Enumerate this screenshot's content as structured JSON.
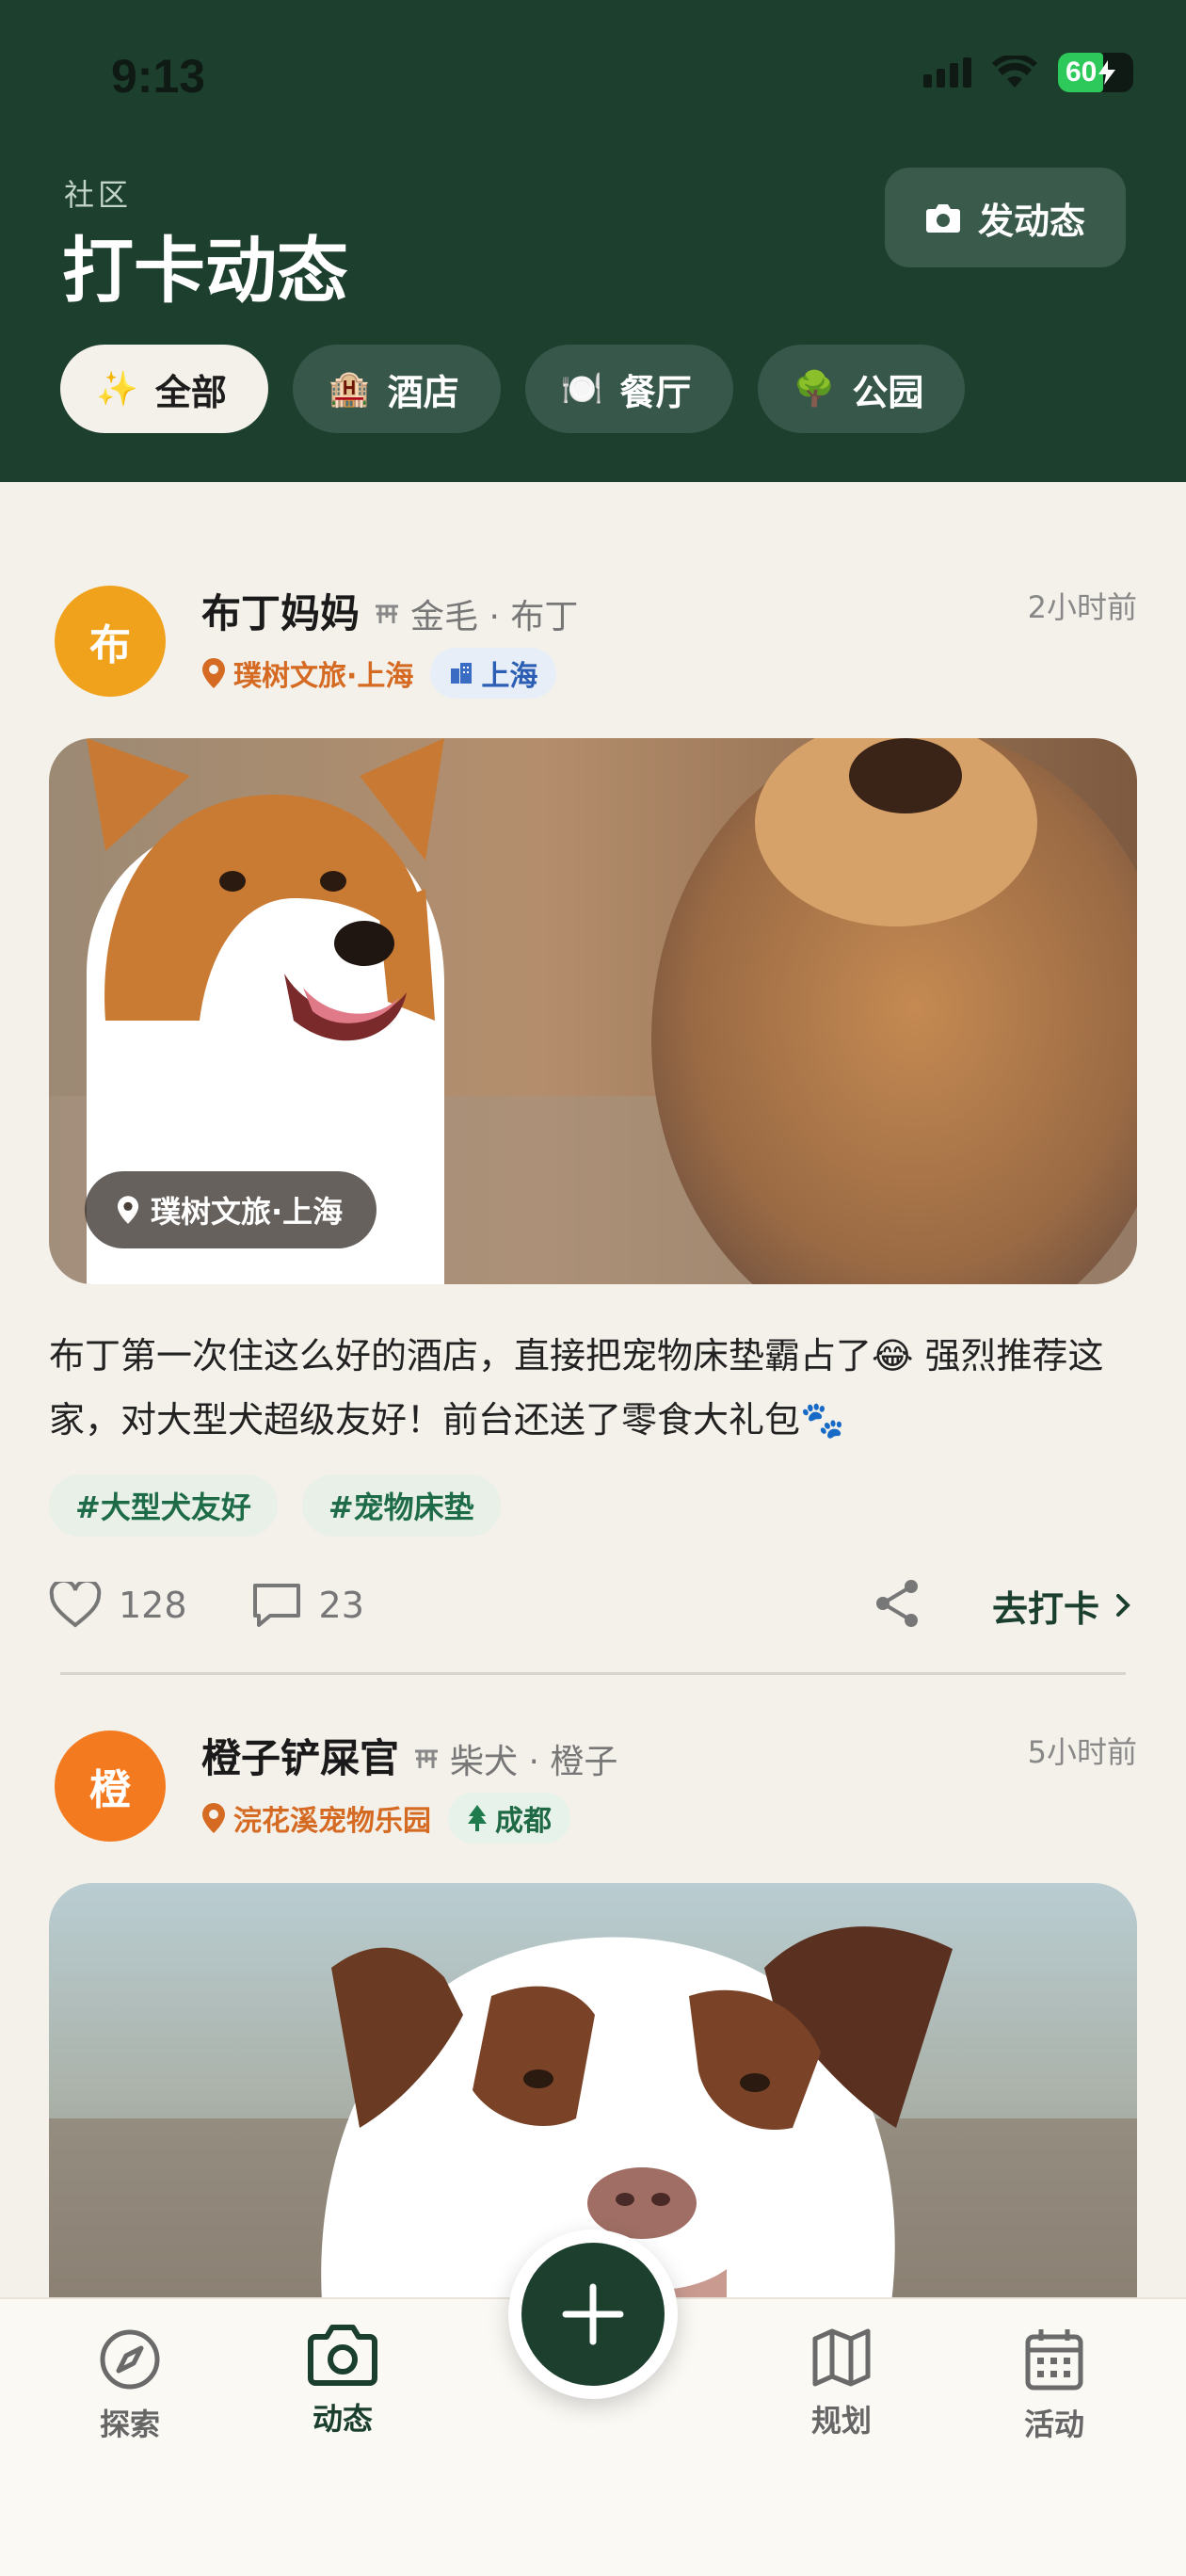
{
  "status_bar": {
    "time": "9:13",
    "battery": "60"
  },
  "header": {
    "subtitle": "社区",
    "title": "打卡动态",
    "post_button": "发动态",
    "filters": [
      {
        "label": "全部",
        "emoji": "✨",
        "active": true
      },
      {
        "label": "酒店",
        "emoji": "🏨",
        "active": false
      },
      {
        "label": "餐厅",
        "emoji": "🍽️",
        "active": false
      },
      {
        "label": "公园",
        "emoji": "🌳",
        "active": false
      }
    ]
  },
  "posts": [
    {
      "avatar_char": "布",
      "avatar_color": "#f0a21c",
      "user": "布丁妈妈",
      "pet": "金毛 · 布丁",
      "time": "2小时前",
      "location": "璞树文旅·上海",
      "city": "上海",
      "city_icon": "building-icon",
      "photo_tag": "璞树文旅·上海",
      "caption": "布丁第一次住这么好的酒店，直接把宠物床垫霸占了😂 强烈推荐这家，对大型犬超级友好！前台还送了零食大礼包🐾",
      "tags": [
        "#大型犬友好",
        "#宠物床垫"
      ],
      "likes": "128",
      "comments": "23",
      "checkin_label": "去打卡"
    },
    {
      "avatar_char": "橙",
      "avatar_color": "#f47a1f",
      "user": "橙子铲屎官",
      "pet": "柴犬 · 橙子",
      "time": "5小时前",
      "location": "浣花溪宠物乐园",
      "city": "成都",
      "city_icon": "tree-icon"
    }
  ],
  "bottom_nav": [
    {
      "label": "探索",
      "icon": "compass-icon"
    },
    {
      "label": "动态",
      "icon": "camera-icon",
      "active": true
    },
    {
      "label": "规划",
      "icon": "map-icon"
    },
    {
      "label": "活动",
      "icon": "calendar-icon"
    }
  ],
  "colors": {
    "primary": "#1c3f2e",
    "orange": "#d56a23",
    "background": "#f4f1ea"
  }
}
